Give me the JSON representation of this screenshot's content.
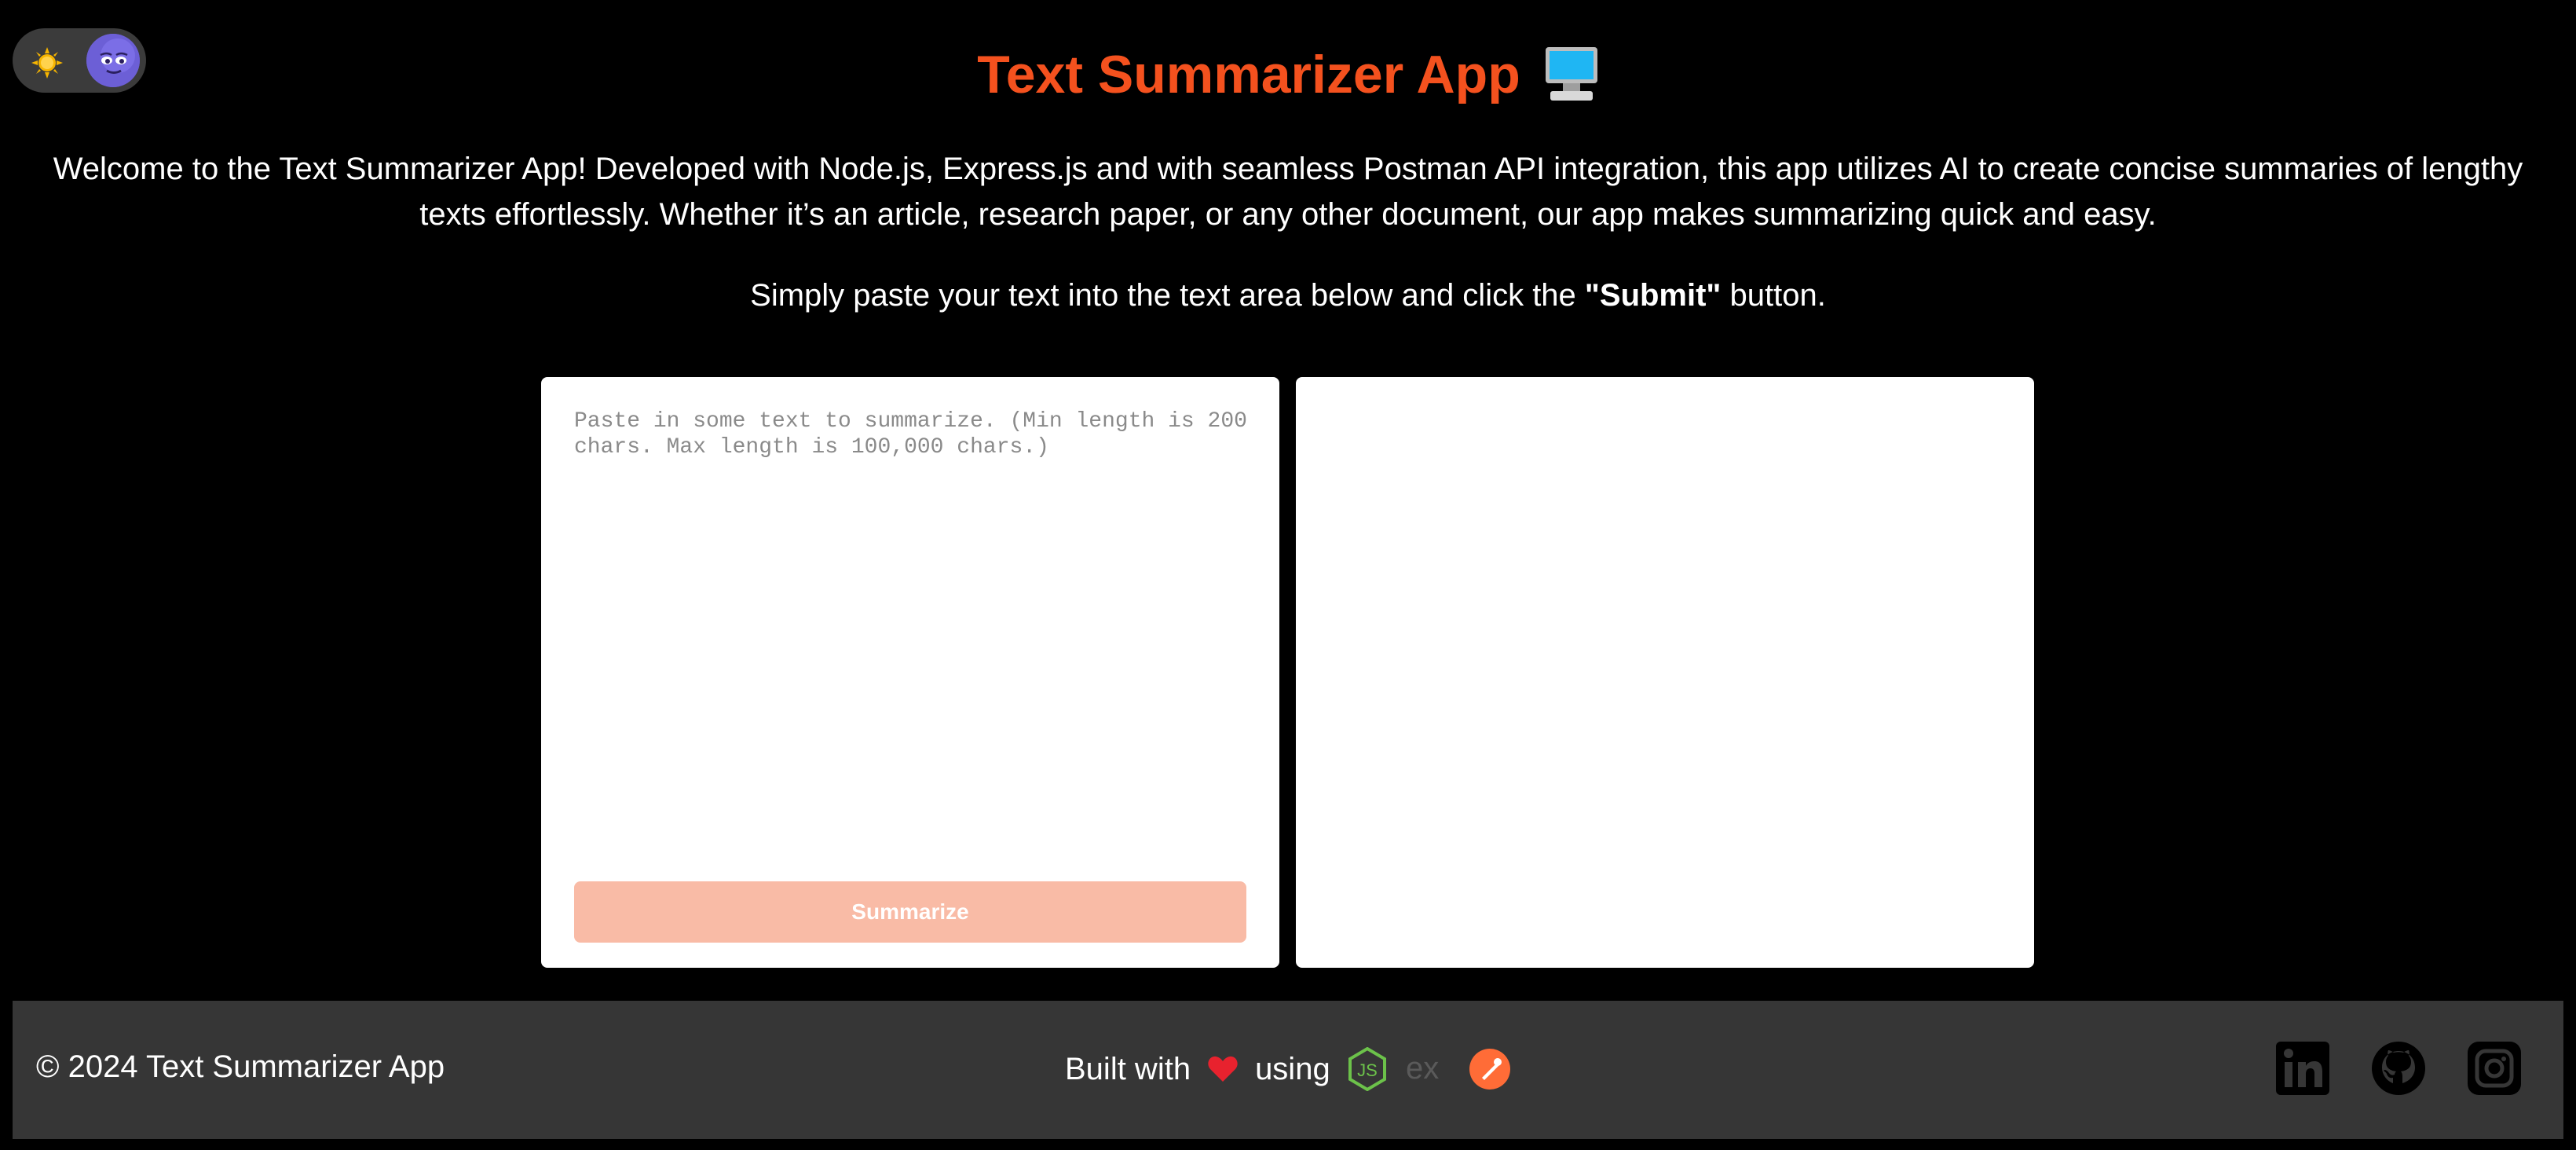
{
  "header": {
    "title": "Text Summarizer App",
    "title_icon": "desktop-monitor-icon",
    "accent_color": "#f4511e"
  },
  "theme_toggle": {
    "light_icon": "sun-icon",
    "dark_icon": "moon-face-icon"
  },
  "intro": {
    "paragraph": "Welcome to the Text Summarizer App! Developed with Node.js, Express.js and with seamless Postman API integration, this app utilizes AI to create concise summaries of lengthy texts effortlessly. Whether it’s an article, research paper, or any other document, our app makes summarizing quick and easy.",
    "instruction_before": "Simply paste your text into the text area below and click the ",
    "instruction_bold": "\"Submit\"",
    "instruction_after": " button."
  },
  "input_panel": {
    "placeholder": "Paste in some text to summarize. (Min length is 200 chars. Max length is 100,000 chars.)",
    "button_label": "Summarize",
    "button_color": "#f9bba6"
  },
  "output_panel": {
    "summary": ""
  },
  "footer": {
    "copyright": "© 2024 Text Summarizer App",
    "built_with": "Built with",
    "using": "using",
    "heart_icon": "heart-icon",
    "tech_icons": [
      "nodejs-icon",
      "express-icon",
      "postman-icon"
    ],
    "social_icons": [
      "linkedin-icon",
      "github-icon",
      "instagram-icon"
    ],
    "background": "#363636"
  }
}
